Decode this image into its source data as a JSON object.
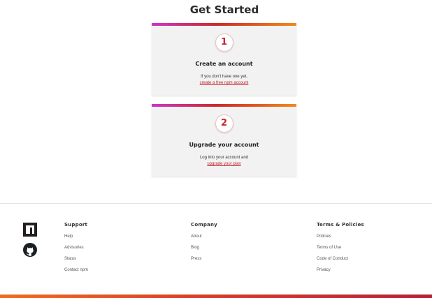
{
  "page": {
    "title": "Get Started"
  },
  "cards": [
    {
      "number": "1",
      "title": "Create an account",
      "desc_prefix": "If you don't have one yet,",
      "link_label": "create a free npm account"
    },
    {
      "number": "2",
      "title": "Upgrade your account",
      "desc_prefix": "Log into your account and",
      "link_label": "upgrade your plan"
    }
  ],
  "footer": {
    "icons": [
      "npm-logo-icon",
      "github-icon"
    ],
    "columns": [
      {
        "heading": "Support",
        "links": [
          "Help",
          "Advisories",
          "Status",
          "Contact npm"
        ]
      },
      {
        "heading": "Company",
        "links": [
          "About",
          "Blog",
          "Press"
        ]
      },
      {
        "heading": "Terms & Policies",
        "links": [
          "Policies",
          "Terms of Use",
          "Code of Conduct",
          "Privacy"
        ]
      }
    ]
  },
  "colors": {
    "accent": "#c0282f",
    "gradient_start": "#c936c9",
    "gradient_mid": "#cc2a2a",
    "gradient_end": "#f08a1e"
  }
}
